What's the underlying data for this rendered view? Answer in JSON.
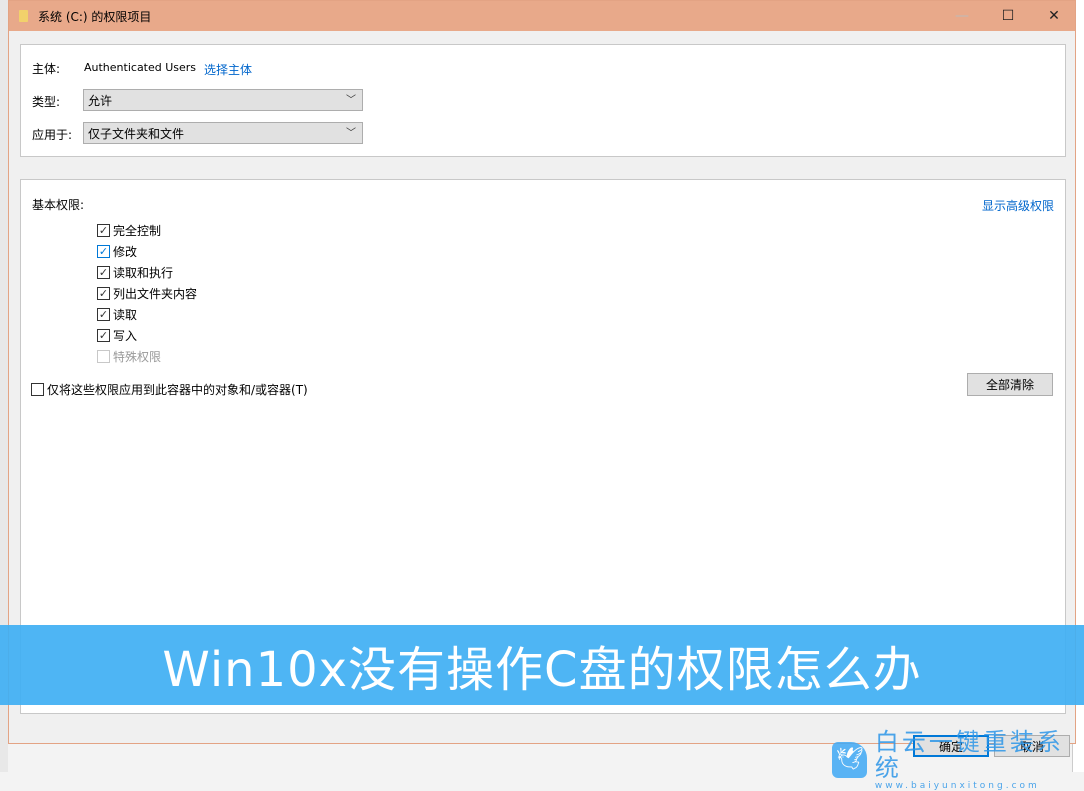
{
  "window": {
    "title": "系统 (C:) 的权限项目",
    "minimize": "—",
    "maximize": "☐",
    "close": "✕"
  },
  "principal": {
    "label": "主体:",
    "value": "Authenticated Users",
    "select_link": "选择主体"
  },
  "type": {
    "label": "类型:",
    "value": "允许"
  },
  "applies_to": {
    "label": "应用于:",
    "value": "仅子文件夹和文件"
  },
  "permissions": {
    "heading": "基本权限:",
    "advanced_link": "显示高级权限",
    "items": [
      {
        "label": "完全控制",
        "checked": true
      },
      {
        "label": "修改",
        "checked": true
      },
      {
        "label": "读取和执行",
        "checked": true
      },
      {
        "label": "列出文件夹内容",
        "checked": true
      },
      {
        "label": "读取",
        "checked": true
      },
      {
        "label": "写入",
        "checked": true
      },
      {
        "label": "特殊权限",
        "checked": false,
        "disabled": true
      }
    ],
    "apply_only_label": "仅将这些权限应用到此容器中的对象和/或容器(T)",
    "clear_all": "全部清除"
  },
  "footer": {
    "ok": "确定",
    "cancel": "取消"
  },
  "banner": {
    "text": "Win10x没有操作C盘的权限怎么办",
    "color": "#3fafF3"
  },
  "watermark": {
    "name": "白云一键重装系统",
    "url": "www.baiyunxitong.com"
  }
}
